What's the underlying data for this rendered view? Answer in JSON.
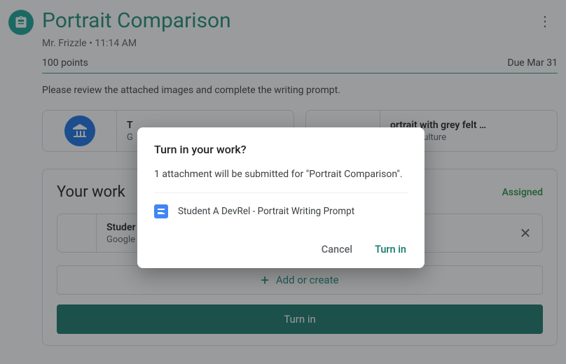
{
  "assignment": {
    "title": "Portrait Comparison",
    "author": "Mr. Frizzle",
    "time": "11:14 AM",
    "points": "100 points",
    "due": "Due Mar 31",
    "instructions": "Please review the attached images and complete the writing prompt."
  },
  "attachments": [
    {
      "title": "T",
      "source": "G"
    },
    {
      "title": "ortrait with grey felt …",
      "source": "Arts & Culture"
    }
  ],
  "your_work": {
    "heading": "Your work",
    "status": "Assigned",
    "file_title": "Studer",
    "file_type": "Google",
    "add_label": "Add or create",
    "turn_in_label": "Turn in"
  },
  "dialog": {
    "title": "Turn in your work?",
    "body": "1 attachment will be submitted for \"Portrait Comparison\".",
    "file_name": "Student A DevRel - Portrait Writing Prompt",
    "cancel": "Cancel",
    "confirm": "Turn in"
  }
}
